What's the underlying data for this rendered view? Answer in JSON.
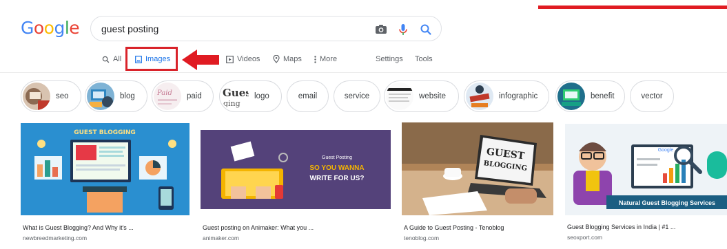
{
  "logo": {
    "letters": [
      "G",
      "o",
      "o",
      "g",
      "l",
      "e"
    ],
    "colors": [
      "#4285f4",
      "#ea4335",
      "#fbbc05",
      "#4285f4",
      "#34a853",
      "#ea4335"
    ]
  },
  "search": {
    "query": "guest posting",
    "icons": [
      "camera-icon",
      "mic-icon",
      "search-icon"
    ]
  },
  "tabs": {
    "all": "All",
    "images": "Images",
    "videos": "Videos",
    "maps": "Maps",
    "more": "More",
    "settings": "Settings",
    "tools": "Tools"
  },
  "chips": [
    {
      "label": "seo"
    },
    {
      "label": "blog"
    },
    {
      "label": "paid"
    },
    {
      "label": "logo"
    },
    {
      "label": "email"
    },
    {
      "label": "service"
    },
    {
      "label": "website"
    },
    {
      "label": "infographic"
    },
    {
      "label": "benefit"
    },
    {
      "label": "vector"
    }
  ],
  "results": [
    {
      "caption": "What is Guest Blogging? And Why it's ...",
      "source": "newbreedmarketing.com",
      "image_text": "GUEST BLOGGING"
    },
    {
      "caption": "Guest posting on Animaker: What you ...",
      "source": "animaker.com",
      "image_text": [
        "Guest Posting",
        "SO YOU WANNA",
        "WRITE FOR US?"
      ]
    },
    {
      "caption": "A Guide to Guest Posting - Tenoblog",
      "source": "tenoblog.com",
      "image_text": [
        "GUEST",
        "BLOGGING"
      ]
    },
    {
      "caption": "Guest Blogging Services in India | #1 ...",
      "source": "seoxport.com",
      "image_text": [
        "Natural Guest Blogging Services",
        "Google"
      ]
    }
  ],
  "colors": {
    "accent": "#1a73e8",
    "highlight_red": "#d9232a"
  }
}
